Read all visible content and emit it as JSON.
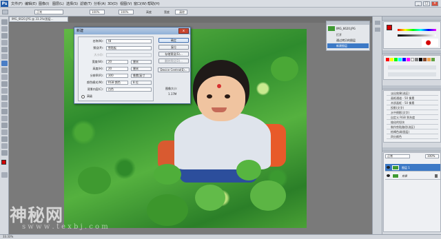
{
  "app": {
    "logo": "Ps"
  },
  "menu": [
    "文件(F)",
    "编辑(E)",
    "图像(I)",
    "图层(L)",
    "选择(S)",
    "滤镜(T)",
    "分析(A)",
    "3D(D)",
    "视图(V)",
    "窗口(W)",
    "帮助(H)"
  ],
  "window_buttons": [
    "_",
    "□",
    "×"
  ],
  "options_bar": {
    "mode_value": "正常",
    "opacity_value": "100%",
    "label_width": "宽度",
    "label_height": "高度",
    "clear_button": "清除"
  },
  "document_tab": "IMG_6620.JPG @ 33.3%(图层...",
  "dialog": {
    "title": "新建",
    "close": "x",
    "fields": [
      {
        "label": "名称(N):",
        "value": "t8"
      },
      {
        "label": "预设(P):",
        "value": "剪贴板"
      },
      {
        "label": "大小(I):",
        "value": ""
      },
      {
        "label": "宽度(W):",
        "value": "20",
        "unit": "厘米"
      },
      {
        "label": "高度(H):",
        "value": "20",
        "unit": "厘米"
      },
      {
        "label": "分辨率(R):",
        "value": "300",
        "unit": "像素/英寸"
      },
      {
        "label": "颜色模式(M):",
        "value": "RGB 颜色",
        "unit": "8 位"
      },
      {
        "label": "背景内容(C):",
        "value": "白色"
      }
    ],
    "advanced": "高级",
    "buttons": [
      "确定",
      "复位",
      "存储预设(S)...",
      "删除预设(D)...",
      "Device Central(E)..."
    ],
    "size_label": "图像大小:",
    "size_value": "1.17M"
  },
  "history_panel": {
    "doc": "IMG_6620.JPG",
    "items": [
      "打开",
      "通过拷贝的图层",
      "新建图层"
    ]
  },
  "actions_panel": {
    "items": [
      "淡出效果(选区)",
      "画框通道 - 50 像素",
      "木质画框 - 50 像素",
      "投影(文字)",
      "水中倒影(文字)",
      "自定义 RGB 到灰度",
      "熔化的铅块",
      "制作剪贴路径(选区)",
      "棕褐色调(图层)",
      "四分颜色",
      "存储为 Photoshop PDF"
    ]
  },
  "layers_panel": {
    "blend": "正常",
    "opacity": "100%",
    "layers": [
      {
        "name": "图层 1",
        "selected": true
      },
      {
        "name": "背景",
        "selected": false
      }
    ]
  },
  "status": {
    "zoom": "33.33%"
  },
  "watermark": {
    "text": "神秘网",
    "sub": "s w w w . t e x b j . c o m"
  },
  "colors": {
    "foreground": "#d40000",
    "background": "#ffffff",
    "accent": "#3c79c6"
  }
}
